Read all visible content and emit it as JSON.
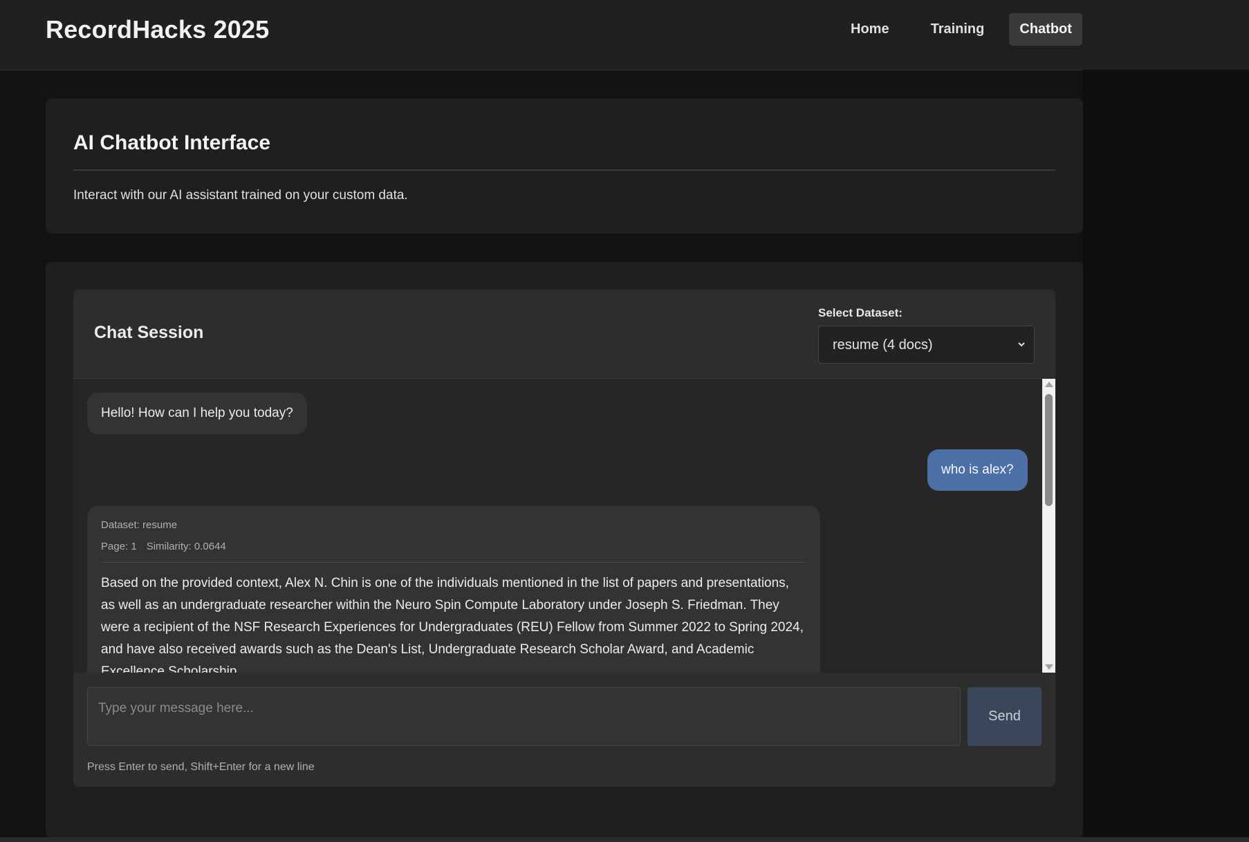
{
  "app": {
    "brand": "RecordHacks 2025"
  },
  "nav": {
    "items": [
      {
        "label": "Home",
        "active": false
      },
      {
        "label": "Training",
        "active": false
      },
      {
        "label": "Chatbot",
        "active": true
      }
    ]
  },
  "intro": {
    "title": "AI Chatbot Interface",
    "description": "Interact with our AI assistant trained on your custom data."
  },
  "chat": {
    "title": "Chat Session",
    "dataset_label": "Select Dataset:",
    "dataset_selected": "resume (4 docs)",
    "messages": [
      {
        "role": "bot",
        "text": "Hello! How can I help you today?"
      },
      {
        "role": "user",
        "text": "who is alex?"
      },
      {
        "role": "bot",
        "dataset": "Dataset: resume",
        "page": "Page: 1",
        "similarity": "Similarity: 0.0644",
        "text": "Based on the provided context, Alex N. Chin is one of the individuals mentioned in the list of papers and presentations, as well as an undergraduate researcher within the Neuro Spin Compute Laboratory under Joseph S. Friedman. They were a recipient of the NSF Research Experiences for Undergraduates (REU) Fellow from Summer 2022 to Spring 2024, and have also received awards such as the Dean's List, Undergraduate Research Scholar Award, and Academic Excellence Scholarship."
      }
    ],
    "input_placeholder": "Type your message here...",
    "send_label": "Send",
    "hint": "Press Enter to send, Shift+Enter for a new line"
  },
  "colors": {
    "page_bg": "#121212",
    "card_bg": "#1f1f1f",
    "user_bubble": "#4c6fa6",
    "bot_bubble": "#333333",
    "send_button": "#3a475b"
  }
}
